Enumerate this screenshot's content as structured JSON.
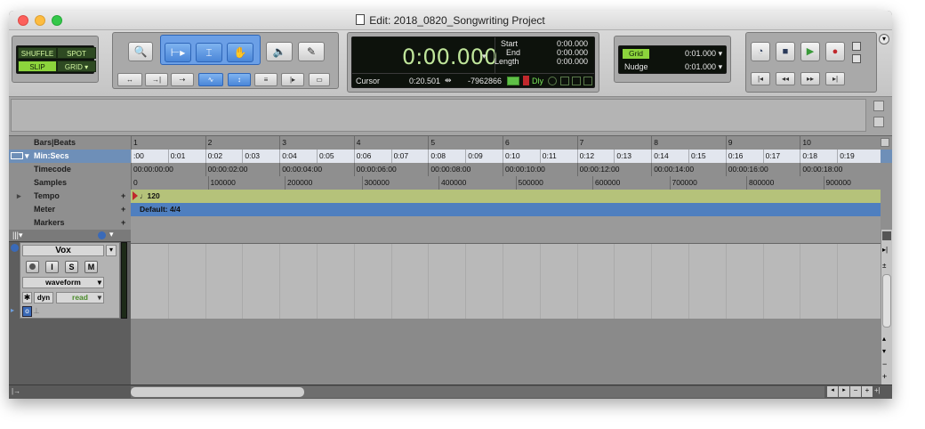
{
  "window": {
    "title": "Edit: 2018_0820_Songwriting Project"
  },
  "edit_modes": {
    "shuffle": "SHUFFLE",
    "spot": "SPOT",
    "slip": "SLIP",
    "grid": "GRID"
  },
  "counter": {
    "main": "0:00.000",
    "start_label": "Start",
    "start_value": "0:00.000",
    "end_label": "End",
    "end_value": "0:00.000",
    "length_label": "Length",
    "length_value": "0:00.000",
    "cursor_label": "Cursor",
    "cursor_value": "0:20.501",
    "sample_value": "-7962866",
    "dly_label": "Dly"
  },
  "grid_nudge": {
    "grid_label": "Grid",
    "grid_value": "0:01.000",
    "nudge_label": "Nudge",
    "nudge_value": "0:01.000"
  },
  "rulers": {
    "bars_label": "Bars|Beats",
    "minsecs_label": "Min:Secs",
    "timecode_label": "Timecode",
    "samples_label": "Samples",
    "bars": [
      "1",
      "2",
      "3",
      "4",
      "5",
      "6",
      "7",
      "8",
      "9",
      "10"
    ],
    "minsecs": [
      ":00",
      "0:01",
      "0:02",
      "0:03",
      "0:04",
      "0:05",
      "0:06",
      "0:07",
      "0:08",
      "0:09",
      "0:10",
      "0:11",
      "0:12",
      "0:13",
      "0:14",
      "0:15",
      "0:16",
      "0:17",
      "0:18",
      "0:19"
    ],
    "timecode": [
      "00:00:00:00",
      "00:00:02:00",
      "00:00:04:00",
      "00:00:06:00",
      "00:00:08:00",
      "00:00:10:00",
      "00:00:12:00",
      "00:00:14:00",
      "00:00:16:00",
      "00:00:18:00"
    ],
    "samples": [
      "0",
      "100000",
      "200000",
      "300000",
      "400000",
      "500000",
      "600000",
      "700000",
      "800000",
      "900000"
    ]
  },
  "conductor": {
    "tempo_label": "Tempo",
    "tempo_value": "120",
    "meter_label": "Meter",
    "meter_value": "Default: 4/4",
    "markers_label": "Markers"
  },
  "track": {
    "name": "Vox",
    "rec": "",
    "input": "I",
    "solo": "S",
    "mute": "M",
    "view": "waveform",
    "dyn": "dyn",
    "automation": "read"
  },
  "colors": {
    "tempo_ruler": "#b5c27a",
    "meter_ruler": "#4f7fbf",
    "selected_tool": "#4a86d8",
    "lcd_green": "#8cd43c"
  },
  "icons": {
    "zoom": "magnifier-icon",
    "trim": "trim-icon",
    "selector": "selector-icon",
    "grabber": "hand-icon",
    "scrub": "speaker-icon",
    "pencil": "pencil-icon",
    "transport": [
      "online-icon",
      "stop-icon",
      "play-icon",
      "record-icon"
    ]
  }
}
